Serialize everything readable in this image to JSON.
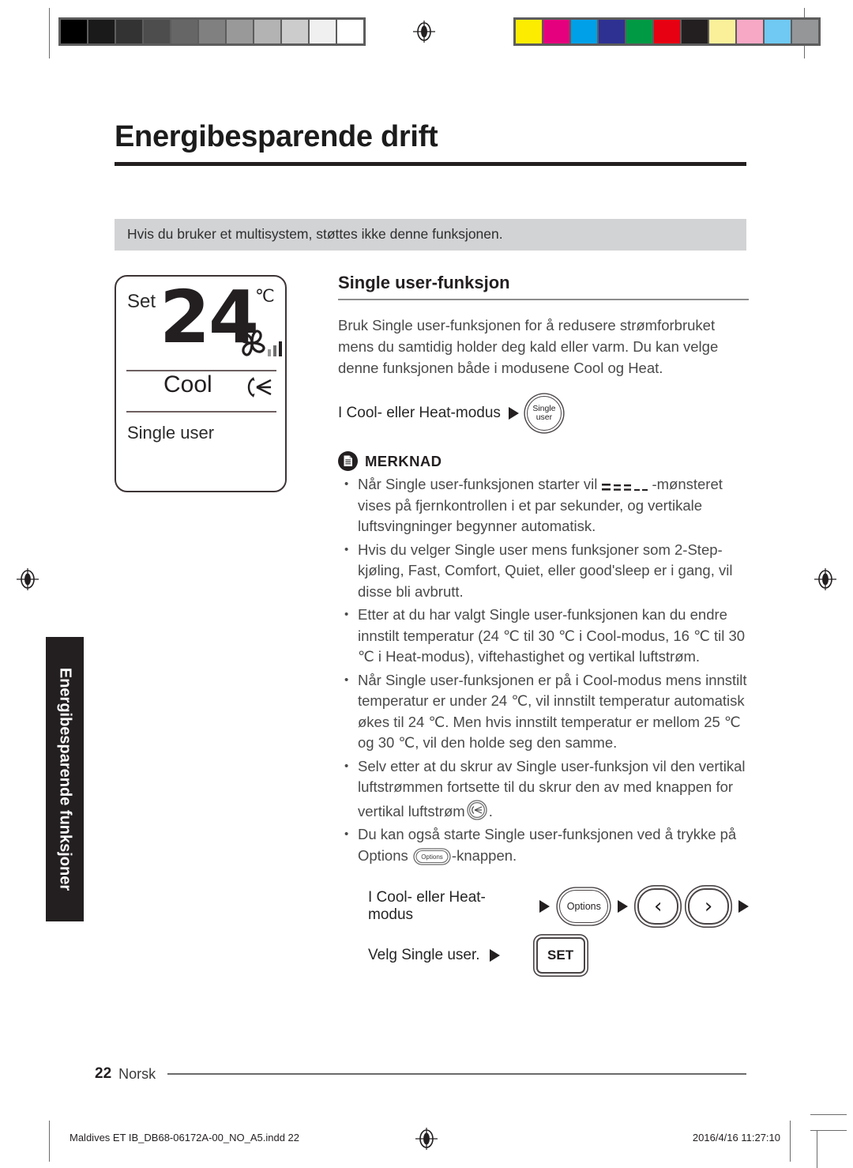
{
  "document": {
    "title": "Energibesparende drift",
    "notice": "Hvis du bruker et multisystem, støttes ikke denne funksjonen.",
    "side_tab": "Energibesparende funksjoner",
    "page_number": "22",
    "page_language": "Norsk",
    "production_file": "Maldives ET IB_DB68-06172A-00_NO_A5.indd   22",
    "production_timestamp": "2016/4/16   11:27:10"
  },
  "lcd": {
    "set_label": "Set",
    "temperature": "24",
    "unit": "℃",
    "mode": "Cool",
    "function": "Single user",
    "fan_icon": "fan-icon",
    "fan_bars": "3",
    "swing_icon": "vertical-airflow-icon"
  },
  "section": {
    "heading": "Single user-funksjon",
    "intro": "Bruk Single user-funksjonen for å redusere strømforbruket mens du samtidig holder deg kald eller varm. Du kan velge denne funksjonen både i modusene Cool og Heat.",
    "step_intro_label": "I Cool- eller  Heat-modus",
    "single_user_button": {
      "line1": "Single",
      "line2": "user"
    }
  },
  "note": {
    "icon": "note-document-icon",
    "title": "MERKNAD",
    "bullets": [
      {
        "before": "Når Single user-funksjonen starter vil ",
        "glyph": "dash-pattern-icon",
        "after": "-mønsteret vises på fjernkontrollen i et par sekunder, og vertikale luftsvingninger begynner automatisk."
      },
      {
        "before": "Hvis du velger Single user mens funksjoner som  2-Step-kjøling, Fast, Comfort, Quiet, eller good'sleep er i gang, vil disse bli avbrutt.",
        "glyph": "",
        "after": ""
      },
      {
        "before": "Etter at du har valgt Single user-funksjonen kan du endre innstilt temperatur (24 ℃ til 30 ℃ i Cool-modus, 16 ℃ til 30 ℃ i Heat-modus), viftehastighet og vertikal luftstrøm.",
        "glyph": "",
        "after": ""
      },
      {
        "before": "Når Single user-funksjonen er på i Cool-modus mens innstilt temperatur er under 24 ℃, vil innstilt temperatur automatisk økes til 24 ℃. Men hvis innstilt temperatur er mellom 25 ℃ og 30 ℃, vil den holde seg den samme.",
        "glyph": "",
        "after": ""
      },
      {
        "before": "Selv etter at du skrur av Single user-funksjon vil den vertikal luftstrømmen fortsette til du skrur den av med knappen for vertikal luftstrøm",
        "glyph": "vertical-airflow-button-icon",
        "after": "."
      },
      {
        "before": "Du kan også starte Single user-funksjonen ved å trykke på Options ",
        "glyph": "options-button-icon",
        "after": "-knappen."
      }
    ]
  },
  "steps": [
    {
      "label": "I Cool- eller  Heat-modus",
      "buttons": [
        "Options",
        "‹",
        "›"
      ],
      "trailing_arrow": true
    },
    {
      "label": "Velg Single user.",
      "buttons": [
        "SET"
      ],
      "trailing_arrow": false
    }
  ],
  "buttons": {
    "options_label": "Options",
    "left_arrow": "‹",
    "right_arrow": "›",
    "set_label": "SET"
  },
  "calibration": {
    "grayscale": [
      "#000000",
      "#1a1a1a",
      "#333333",
      "#4d4d4d",
      "#666666",
      "#808080",
      "#999999",
      "#b3b3b3",
      "#cccccc",
      "#f0f0f0",
      "#ffffff"
    ],
    "colors": [
      "#fced00",
      "#e5007d",
      "#00a0e9",
      "#2e3192",
      "#009944",
      "#e60012",
      "#231f20",
      "#faf09a",
      "#f6a8c5",
      "#6fc9f2",
      "#949698"
    ]
  }
}
